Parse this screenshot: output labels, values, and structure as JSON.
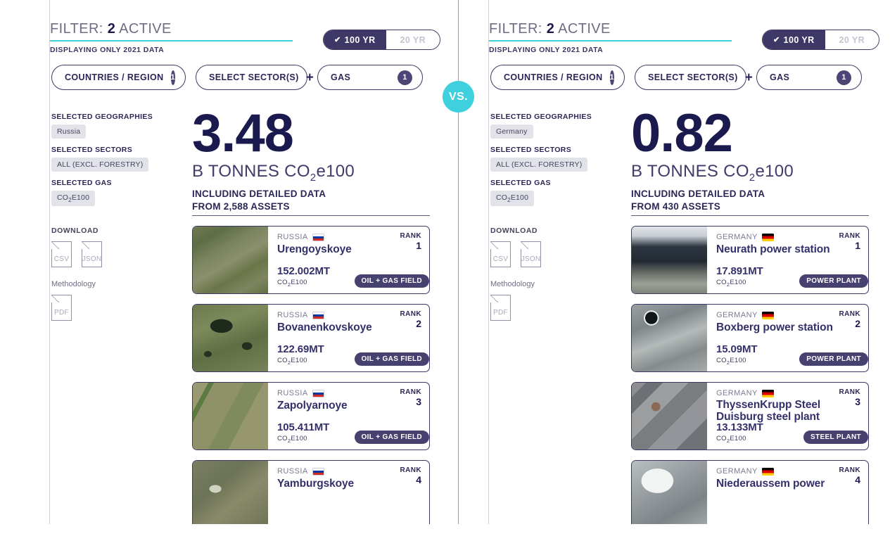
{
  "center": {
    "vs_label": "VS."
  },
  "panels": [
    {
      "id": "left",
      "filter": {
        "title_prefix": "FILTER:",
        "count": "2",
        "title_suffix": "ACTIVE",
        "subtitle": "DISPLAYING ONLY 2021 DATA"
      },
      "year_toggle": {
        "active_label": "100 YR",
        "inactive_label": "20 YR",
        "check_icon": "check-icon",
        "active_color": "#3d3866"
      },
      "pills": [
        {
          "label": "COUNTRIES / REGION",
          "count": "1"
        },
        {
          "label": "SELECT SECTOR(S)",
          "plus": "+"
        },
        {
          "label": "GAS",
          "count": "1"
        }
      ],
      "sidebar": {
        "geographies_label": "SELECTED GEOGRAPHIES",
        "geographies_tag": "Russia",
        "sectors_label": "SELECTED SECTORS",
        "sectors_tag": "ALL (EXCL. FORESTRY)",
        "gas_label": "SELECTED GAS",
        "gas_tag_main": "CO",
        "gas_tag_sub": "2",
        "gas_tag_rest": "E100",
        "download_label": "DOWNLOAD",
        "csv_label": "CSV",
        "json_label": "JSON",
        "methodology_label": "Methodology",
        "pdf_label": "PDF"
      },
      "stat": {
        "number": "3.48",
        "unit_prefix": "B TONNES CO",
        "unit_sub": "2",
        "unit_suffix": "e100",
        "detail_line1": "INCLUDING DETAILED DATA",
        "detail_line2": "FROM 2,588 ASSETS"
      },
      "cards": [
        {
          "country": "RUSSIA",
          "flag": "flag-ru",
          "name": "Urengoyskoye",
          "rank_label": "RANK",
          "rank": "1",
          "value": "152.002MT",
          "gas_main": "CO",
          "gas_sub": "2",
          "gas_rest": "E100",
          "badge": "OIL + GAS FIELD",
          "img": "linear-gradient(150deg,#6f7a52 0%,#5e6d46 18%,#7b8460 36%,#8a8f6d 52%,#6a7549 68%,#7d8560 84%,#646f44 100%)"
        },
        {
          "country": "RUSSIA",
          "flag": "flag-ru",
          "name": "Bovanenkovskoye",
          "rank_label": "RANK",
          "rank": "2",
          "value": "122.69MT",
          "gas_main": "CO",
          "gas_sub": "2",
          "gas_rest": "E100",
          "badge": "OIL + GAS FIELD",
          "img": "radial-gradient(ellipse 26px 16px at 38% 32%, #1e2a1c 0 60%, transparent 62%), radial-gradient(ellipse 12px 9px at 72% 62%, #23301f 0 60%, transparent 62%), radial-gradient(ellipse 9px 7px at 20% 74%, #26321f 0 60%, transparent 62%), linear-gradient(160deg,#6c7a4e 0%,#7d8a5c 30%,#5f6e44 60%,#77835a 100%)"
        },
        {
          "country": "RUSSIA",
          "flag": "flag-ru",
          "name": "Zapolyarnoye",
          "rank_label": "RANK",
          "rank": "3",
          "value": "105.411MT",
          "gas_main": "CO",
          "gas_sub": "2",
          "gas_rest": "E100",
          "badge": "OIL + GAS FIELD",
          "img": "linear-gradient(118deg, #9a9a72 0 14%, #5c7a42 14% 19%, #8f9269 19% 46%, #7f8a5e 46% 64%, #96976f 64% 100%)"
        },
        {
          "country": "RUSSIA",
          "flag": "flag-ru",
          "name": "Yamburgskoye",
          "rank_label": "RANK",
          "rank": "4",
          "value": "",
          "gas_main": "",
          "gas_sub": "",
          "gas_rest": "",
          "badge": "",
          "img": "radial-gradient(ellipse 14px 9px at 30% 42%, #cfd4c2 0 60%, transparent 62%), linear-gradient(140deg,#7a7f62 0%,#6c7356 35%,#8a8a6a 60%,#6e7455 100%)"
        }
      ]
    },
    {
      "id": "right",
      "filter": {
        "title_prefix": "FILTER:",
        "count": "2",
        "title_suffix": "ACTIVE",
        "subtitle": "DISPLAYING ONLY 2021 DATA"
      },
      "year_toggle": {
        "active_label": "100 YR",
        "inactive_label": "20 YR",
        "check_icon": "check-icon",
        "active_color": "#3d3866"
      },
      "pills": [
        {
          "label": "COUNTRIES / REGION",
          "count": "1"
        },
        {
          "label": "SELECT SECTOR(S)",
          "plus": "+"
        },
        {
          "label": "GAS",
          "count": "1"
        }
      ],
      "sidebar": {
        "geographies_label": "SELECTED GEOGRAPHIES",
        "geographies_tag": "Germany",
        "sectors_label": "SELECTED SECTORS",
        "sectors_tag": "ALL (EXCL. FORESTRY)",
        "gas_label": "SELECTED GAS",
        "gas_tag_main": "CO",
        "gas_tag_sub": "2",
        "gas_tag_rest": "E100",
        "download_label": "DOWNLOAD",
        "csv_label": "CSV",
        "json_label": "JSON",
        "methodology_label": "Methodology",
        "pdf_label": "PDF"
      },
      "stat": {
        "number": "0.82",
        "unit_prefix": "B TONNES CO",
        "unit_sub": "2",
        "unit_suffix": "e100",
        "detail_line1": "INCLUDING DETAILED DATA",
        "detail_line2": "FROM 430 ASSETS"
      },
      "cards": [
        {
          "country": "GERMANY",
          "flag": "flag-de",
          "name": "Neurath power station",
          "rank_label": "RANK",
          "rank": "1",
          "value": "17.891MT",
          "gas_main": "CO",
          "gas_sub": "2",
          "gas_rest": "E100",
          "badge": "POWER PLANT",
          "img": "linear-gradient(180deg,#dfe4e8 0%,#c8ced4 14%,#2e3741 30%,#222a33 52%,#6b6f69 70%,#9aa096 86%,#7e847b 100%)"
        },
        {
          "country": "GERMANY",
          "flag": "flag-de",
          "name": "Boxberg power station",
          "rank_label": "RANK",
          "rank": "2",
          "value": "15.09MT",
          "gas_main": "CO",
          "gas_sub": "2",
          "gas_rest": "E100",
          "badge": "POWER PLANT",
          "img": "radial-gradient(circle 14px at 26% 20%, #12161a 0 62%, #e6e9ea 63% 76%, transparent 78%), linear-gradient(160deg,#9aa0a2 0%,#7e8588 28%,#b4bab9 52%,#868c8c 74%,#a6acab 100%)"
        },
        {
          "country": "GERMANY",
          "flag": "flag-de",
          "name": "ThyssenKrupp Steel Duisburg steel plant",
          "rank_label": "RANK",
          "rank": "3",
          "value": "13.133MT",
          "gas_main": "CO",
          "gas_sub": "2",
          "gas_rest": "E100",
          "badge": "STEEL PLANT",
          "img": "radial-gradient(circle 9px at 32% 36%, #8a6a55 0 70%, transparent 72%), linear-gradient(135deg,#8e8f92 0 10%,#6d7074 10% 22%,#9b9d9e 22% 40%,#7a7d80 40% 58%,#93959a 58% 78%,#6f7276 78% 100%)"
        },
        {
          "country": "GERMANY",
          "flag": "flag-de",
          "name": "Niederaussem power",
          "rank_label": "RANK",
          "rank": "4",
          "value": "",
          "gas_main": "",
          "gas_sub": "",
          "gas_rest": "",
          "badge": "",
          "img": "radial-gradient(ellipse 34px 26px at 34% 30%, #f2f4f4 0 66%, transparent 68%), linear-gradient(150deg,#b9c0c2 0%,#959b9e 40%,#7d8487 70%,#a3a9aa 100%)"
        }
      ]
    }
  ]
}
